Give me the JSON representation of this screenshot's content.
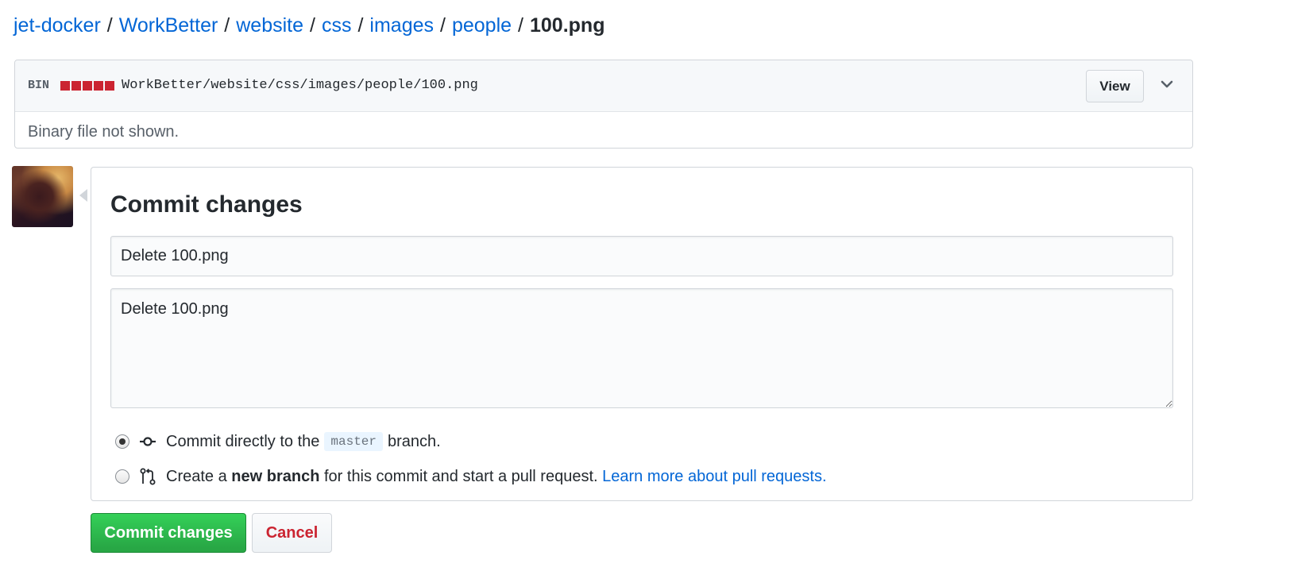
{
  "breadcrumb": {
    "items": [
      "jet-docker",
      "WorkBetter",
      "website",
      "css",
      "images",
      "people"
    ],
    "separator": "/",
    "current": "100.png"
  },
  "file": {
    "bin_label": "BIN",
    "path": "WorkBetter/website/css/images/people/100.png",
    "view_label": "View",
    "body_text": "Binary file not shown.",
    "diff_color": "#cb2431"
  },
  "commit": {
    "title": "Commit changes",
    "summary_value": "Delete 100.png",
    "description_value": "Delete 100.png",
    "option_direct": {
      "prefix": "Commit directly to the",
      "branch": "master",
      "suffix": "branch.",
      "checked": true
    },
    "option_new_branch": {
      "prefix": "Create a",
      "bold": "new branch",
      "suffix": "for this commit and start a pull request.",
      "link": "Learn more about pull requests.",
      "checked": false
    }
  },
  "actions": {
    "commit_label": "Commit changes",
    "cancel_label": "Cancel"
  },
  "colors": {
    "link": "#0366d6",
    "primary_button": "#28a745",
    "danger_text": "#cb2431"
  }
}
